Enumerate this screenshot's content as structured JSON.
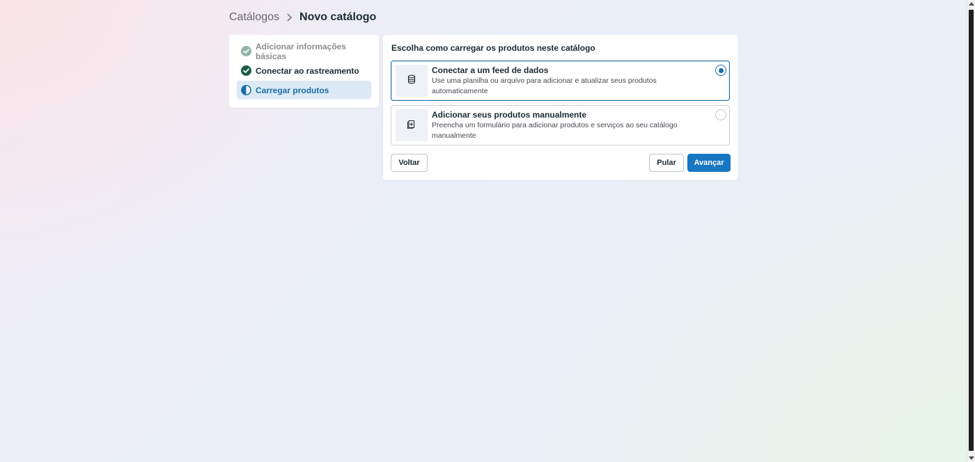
{
  "breadcrumb": {
    "parent": "Catálogos",
    "current": "Novo catálogo"
  },
  "steps": [
    {
      "label": "Adicionar informações básicas",
      "state": "done-faded",
      "icon": "check-circle-icon"
    },
    {
      "label": "Conectar ao rastreamento",
      "state": "done",
      "icon": "check-circle-icon"
    },
    {
      "label": "Carregar produtos",
      "state": "active",
      "icon": "half-circle-icon"
    }
  ],
  "main": {
    "title": "Escolha como carregar os produtos neste catálogo",
    "options": [
      {
        "title": "Conectar a um feed de dados",
        "description": "Use uma planilha ou arquivo para adicionar e atualizar seus produtos automaticamente",
        "icon": "database-icon",
        "selected": true
      },
      {
        "title": "Adicionar seus produtos manualmente",
        "description": "Preencha um formulário para adicionar produtos e serviços ao seu catálogo manualmente",
        "icon": "add-document-icon",
        "selected": false
      }
    ],
    "buttons": {
      "back": "Voltar",
      "skip": "Pular",
      "next": "Avançar"
    }
  },
  "colors": {
    "accent": "#1877c2",
    "active_step_bg": "#dceaf6",
    "done_green": "#1d5c4a"
  }
}
